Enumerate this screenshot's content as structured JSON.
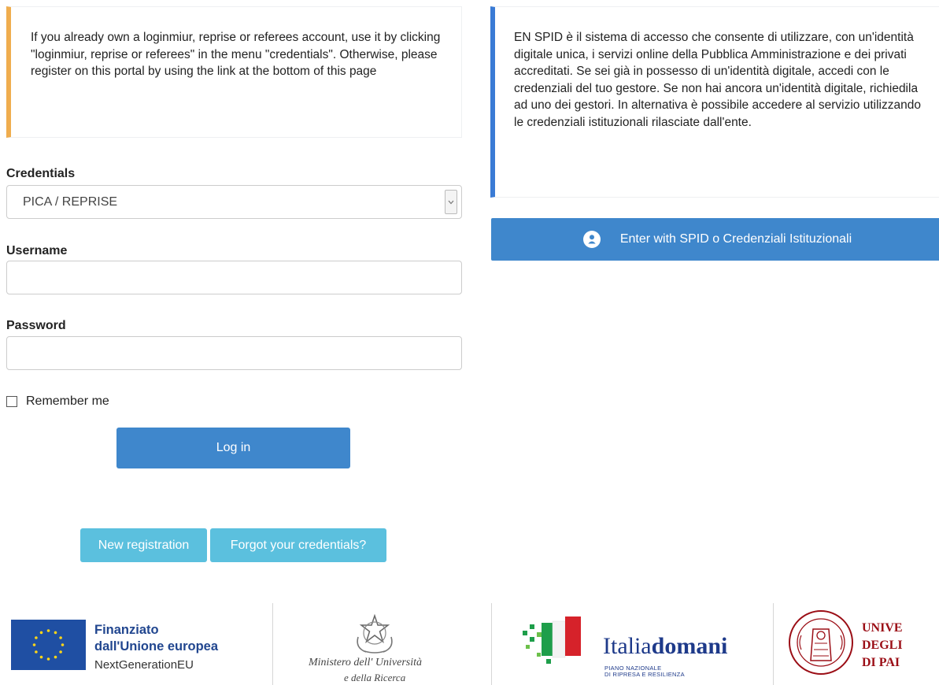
{
  "notice_left": {
    "text": "If you already own a loginmiur, reprise or referees account, use it by clicking \"loginmiur, reprise or referees\" in the menu \"credentials\". Otherwise, please register on this portal by using the link at the bottom of this page"
  },
  "notice_right": {
    "text": "EN SPID è il sistema di accesso che consente di utilizzare, con un'identità digitale unica, i servizi online della Pubblica Amministrazione e dei privati accreditati. Se sei già in possesso di un'identità digitale, accedi con le credenziali del tuo gestore. Se non hai ancora un'identità digitale, richiedila ad uno dei gestori. In alternativa è possibile accedere al servizio utilizzando le credenziali istituzionali rilasciate dall'ente."
  },
  "form": {
    "credentials_label": "Credentials",
    "credentials_value": "PICA / REPRISE",
    "username_label": "Username",
    "username_value": "",
    "password_label": "Password",
    "password_value": "",
    "remember_label": "Remember me",
    "remember_checked": false,
    "login_button": "Log in",
    "new_registration": "New registration",
    "forgot_credentials": "Forgot your credentials?"
  },
  "spid": {
    "button_label": "Enter with SPID o Credenziali Istituzionali",
    "icon": "user-icon"
  },
  "footer": {
    "eu": {
      "line1": "Finanziato",
      "line2": "dall'Unione europea",
      "line3": "NextGenerationEU"
    },
    "ministry": {
      "line1": "Ministero dell' Università",
      "line2": "e della Ricerca"
    },
    "italiadomani": {
      "name_regular": "Italia",
      "name_bold": "domani",
      "sub1": "PIANO NAZIONALE",
      "sub2": "DI RIPRESA E RESILIENZA"
    },
    "university": {
      "line1": "UNIVE",
      "line2": "DEGLI",
      "line3": "DI PAI"
    }
  },
  "colors": {
    "primary_button": "#3f87cc",
    "secondary_button": "#5bc0de",
    "warning_border": "#f0ad4e",
    "info_border": "#3a7bd5",
    "eu_blue": "#1f4fa3",
    "unipd_red": "#9b0e16"
  }
}
